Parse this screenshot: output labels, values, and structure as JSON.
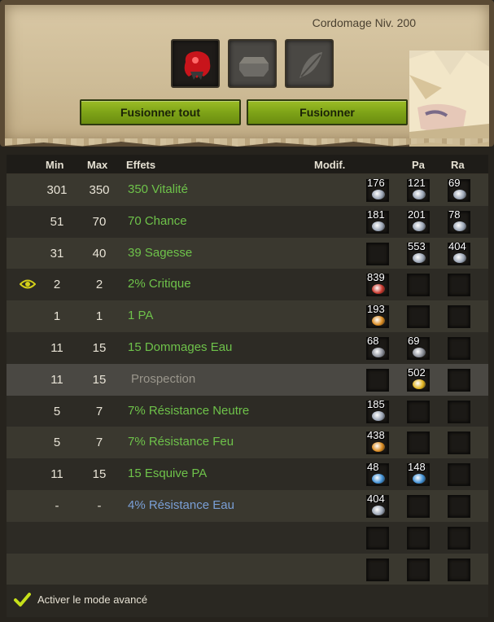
{
  "header": {
    "job_title": "Cordomage Niv. 200",
    "fuse_all_label": "Fusionner tout",
    "fuse_label": "Fusionner"
  },
  "table": {
    "columns": {
      "min": "Min",
      "max": "Max",
      "effects": "Effets",
      "modif": "Modif.",
      "pa": "Pa",
      "ra": "Ra"
    },
    "rows": [
      {
        "min": "301",
        "max": "350",
        "effect": "350 Vitalité",
        "style": "green",
        "runes": [
          "176",
          "121",
          "69"
        ],
        "gems": [
          "#9aa4b4",
          "#9aa4b4",
          "#9aa4b4"
        ]
      },
      {
        "min": "51",
        "max": "70",
        "effect": "70 Chance",
        "style": "green",
        "runes": [
          "181",
          "201",
          "78"
        ],
        "gems": [
          "#9aa4b4",
          "#9aa4b4",
          "#9aa4b4"
        ]
      },
      {
        "min": "31",
        "max": "40",
        "effect": "39 Sagesse",
        "style": "green",
        "runes": [
          "",
          "553",
          "404"
        ],
        "gems": [
          "",
          "#9aa4b4",
          "#9aa4b4"
        ]
      },
      {
        "min": "2",
        "max": "2",
        "effect": "2% Critique",
        "style": "green",
        "eye": true,
        "runes": [
          "839",
          "",
          ""
        ],
        "gems": [
          "#c8352a",
          "",
          ""
        ]
      },
      {
        "min": "1",
        "max": "1",
        "effect": "1 PA",
        "style": "green",
        "runes": [
          "193",
          "",
          ""
        ],
        "gems": [
          "#d9891e",
          "",
          ""
        ]
      },
      {
        "min": "11",
        "max": "15",
        "effect": "15 Dommages Eau",
        "style": "green",
        "runes": [
          "68",
          "69",
          ""
        ],
        "gems": [
          "#8a8e98",
          "#8a8e98",
          ""
        ]
      },
      {
        "min": "11",
        "max": "15",
        "effect": "Prospection",
        "style": "grey",
        "highlight": true,
        "runes": [
          "",
          "502",
          ""
        ],
        "gems": [
          "",
          "#e0b21c",
          ""
        ]
      },
      {
        "min": "5",
        "max": "7",
        "effect": "7% Résistance Neutre",
        "style": "green",
        "runes": [
          "185",
          "",
          ""
        ],
        "gems": [
          "#9aa4b4",
          "",
          ""
        ]
      },
      {
        "min": "5",
        "max": "7",
        "effect": "7% Résistance Feu",
        "style": "green",
        "runes": [
          "438",
          "",
          ""
        ],
        "gems": [
          "#d9891e",
          "",
          ""
        ]
      },
      {
        "min": "11",
        "max": "15",
        "effect": "15 Esquive PA",
        "style": "green",
        "runes": [
          "48",
          "148",
          ""
        ],
        "gems": [
          "#3f8fd4",
          "#3f8fd4",
          ""
        ]
      },
      {
        "min": "-",
        "max": "-",
        "effect": "4% Résistance Eau",
        "style": "blue",
        "runes": [
          "404",
          "",
          ""
        ],
        "gems": [
          "#9aa4b4",
          "",
          ""
        ]
      },
      {
        "min": "",
        "max": "",
        "effect": "",
        "style": "green",
        "runes": [
          "",
          "",
          ""
        ],
        "gems": [
          "",
          "",
          ""
        ]
      },
      {
        "min": "",
        "max": "",
        "effect": "",
        "style": "green",
        "runes": [
          "",
          "",
          ""
        ],
        "gems": [
          "",
          "",
          ""
        ]
      }
    ]
  },
  "footer": {
    "advanced_mode_label": "Activer le mode avancé",
    "advanced_mode_checked": true
  },
  "colors": {
    "effect_green": "#6ec24a",
    "effect_blue": "#7a9fd6",
    "button_green": "#7ea318"
  }
}
